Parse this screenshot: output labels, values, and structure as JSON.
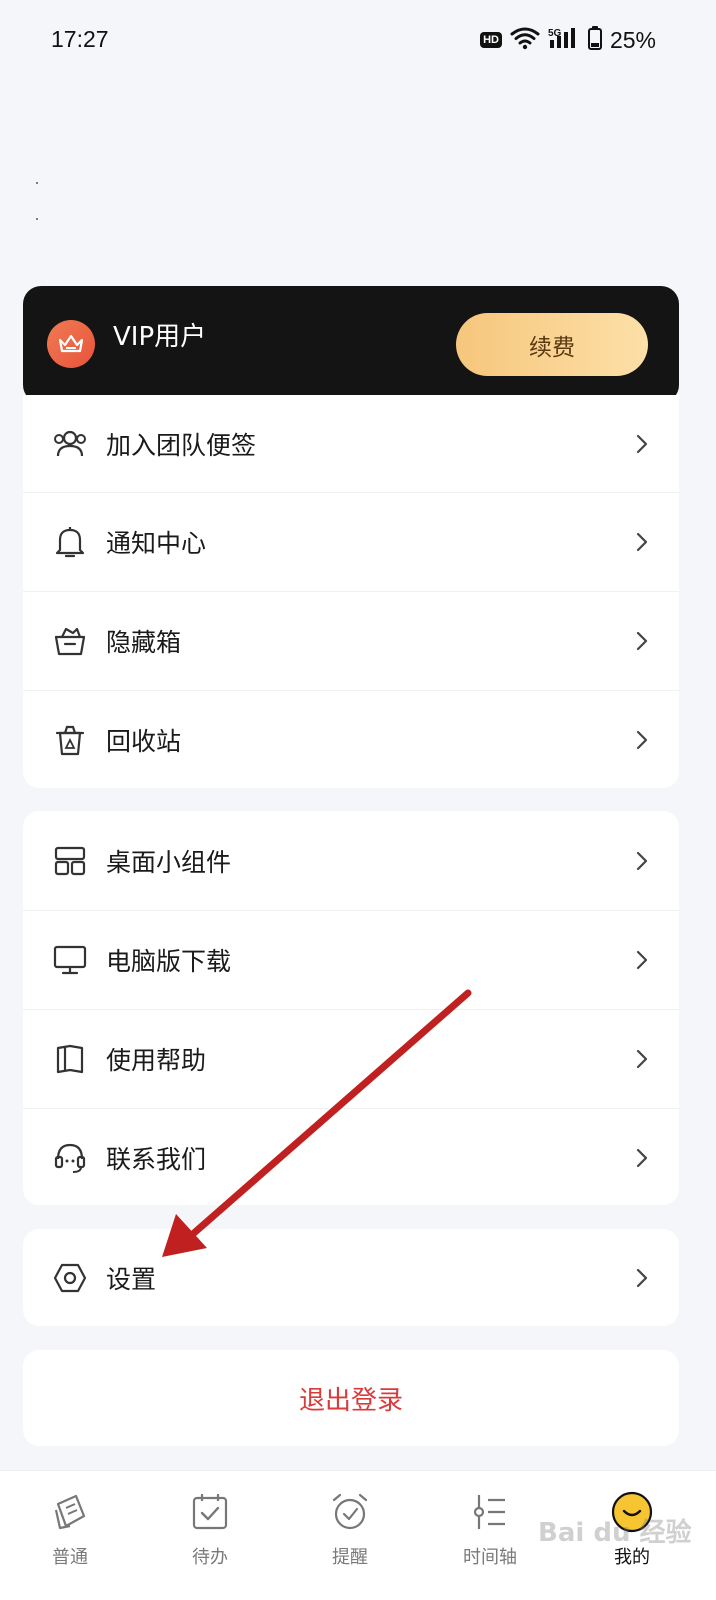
{
  "status": {
    "time": "17:27",
    "hd": "HD",
    "signal": "5G",
    "battery": "25%"
  },
  "vip": {
    "label": "VIP用户",
    "renew_label": "续费"
  },
  "menu_group_1": [
    {
      "label": "加入团队便签",
      "icon": "team-icon"
    },
    {
      "label": "通知中心",
      "icon": "bell-icon"
    },
    {
      "label": "隐藏箱",
      "icon": "hidden-box-icon"
    },
    {
      "label": "回收站",
      "icon": "trash-icon"
    }
  ],
  "menu_group_2": [
    {
      "label": "桌面小组件",
      "icon": "widget-icon"
    },
    {
      "label": "电脑版下载",
      "icon": "desktop-icon"
    },
    {
      "label": "使用帮助",
      "icon": "book-icon"
    },
    {
      "label": "联系我们",
      "icon": "headset-icon"
    }
  ],
  "menu_group_3": [
    {
      "label": "设置",
      "icon": "gear-icon"
    }
  ],
  "logout_label": "退出登录",
  "bottom_nav": [
    {
      "label": "普通",
      "icon": "note-icon",
      "active": false
    },
    {
      "label": "待办",
      "icon": "todo-icon",
      "active": false
    },
    {
      "label": "提醒",
      "icon": "alarm-icon",
      "active": false
    },
    {
      "label": "时间轴",
      "icon": "timeline-icon",
      "active": false
    },
    {
      "label": "我的",
      "icon": "smiley-icon",
      "active": true
    }
  ],
  "watermark": "Bai du 经验",
  "colors": {
    "accent_red": "#d93a3a",
    "vip_card": "#141414",
    "renew_gradient_start": "#f6c67c",
    "renew_gradient_end": "#fde0a8",
    "crown": "#e8543a",
    "active_avatar": "#f7c531",
    "annotation_arrow": "#c0201f"
  }
}
